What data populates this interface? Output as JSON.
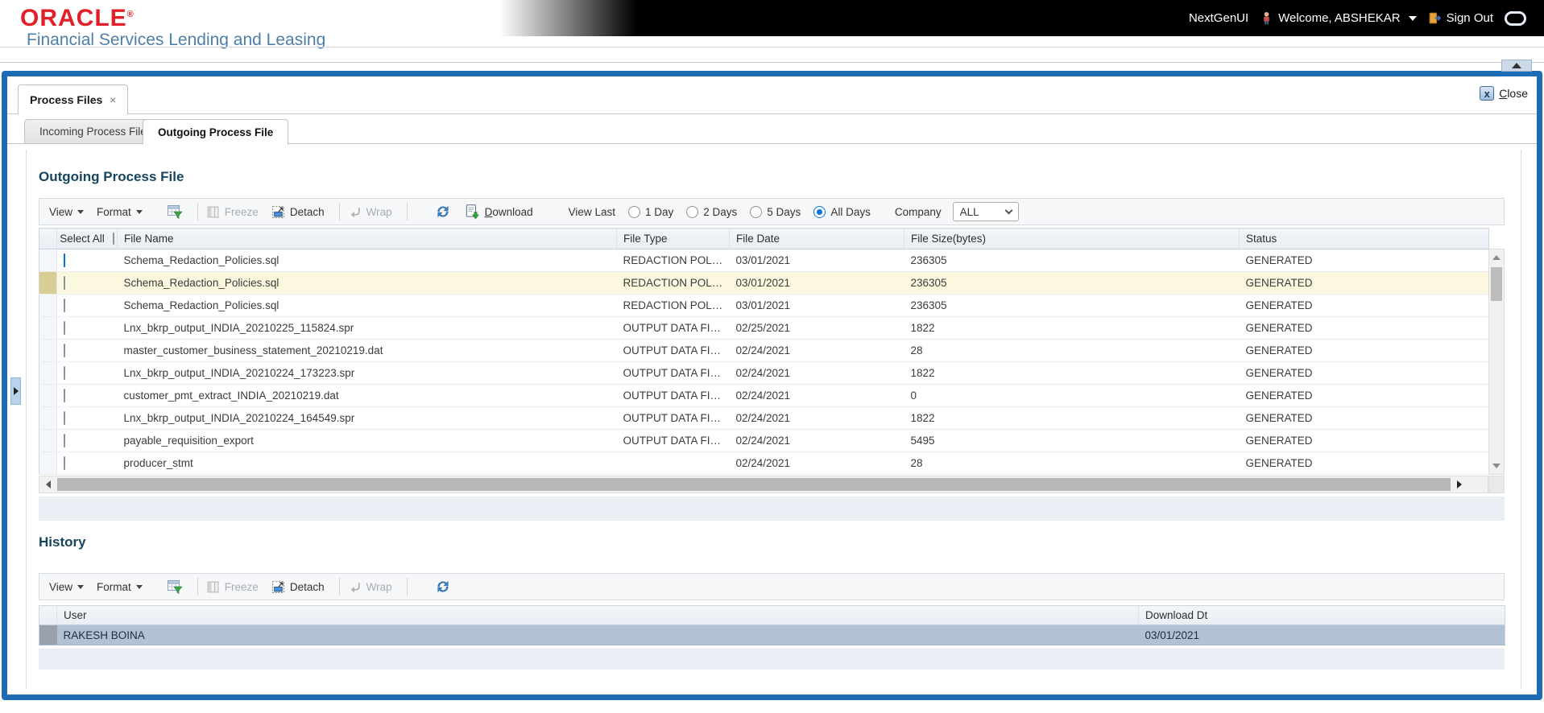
{
  "header": {
    "logo_text": "ORACLE",
    "logo_reg": "®",
    "tagline": "Financial Services Lending and Leasing",
    "topbar": {
      "nextgen_label": "NextGenUI",
      "welcome_label": "Welcome, ABSHEKAR",
      "signout_label": "Sign Out"
    }
  },
  "window": {
    "tab_label": "Process Files",
    "tab_close": "×",
    "close_label": "Close",
    "close_x": "x"
  },
  "subtabs": {
    "incoming": "Incoming Process File",
    "outgoing": "Outgoing Process File"
  },
  "outgoing": {
    "title": "Outgoing Process File",
    "toolbar": {
      "view": "View",
      "format": "Format",
      "freeze": "Freeze",
      "detach": "Detach",
      "wrap": "Wrap",
      "download": "Download"
    },
    "filters": {
      "view_last_label": "View Last",
      "opt_1day": "1 Day",
      "opt_2days": "2 Days",
      "opt_5days": "5 Days",
      "opt_alldays": "All Days",
      "selected_option": "All Days",
      "company_label": "Company",
      "company_value": "ALL"
    },
    "table": {
      "select_all_label": "Select All",
      "col_file_name": "File Name",
      "col_file_type": "File Type",
      "col_file_date": "File Date",
      "col_file_size": "File Size(bytes)",
      "col_status": "Status",
      "rows": [
        {
          "checked": true,
          "selected": false,
          "file_name": "Schema_Redaction_Policies.sql",
          "file_type": "REDACTION POLI...",
          "file_date": "03/01/2021",
          "file_size": "236305",
          "status": "GENERATED"
        },
        {
          "checked": false,
          "selected": true,
          "file_name": "Schema_Redaction_Policies.sql",
          "file_type": "REDACTION POLI...",
          "file_date": "03/01/2021",
          "file_size": "236305",
          "status": "GENERATED"
        },
        {
          "checked": false,
          "selected": false,
          "file_name": "Schema_Redaction_Policies.sql",
          "file_type": "REDACTION POLI...",
          "file_date": "03/01/2021",
          "file_size": "236305",
          "status": "GENERATED"
        },
        {
          "checked": false,
          "selected": false,
          "file_name": "Lnx_bkrp_output_INDIA_20210225_115824.spr",
          "file_type": "OUTPUT DATA FIL...",
          "file_date": "02/25/2021",
          "file_size": "1822",
          "status": "GENERATED"
        },
        {
          "checked": false,
          "selected": false,
          "file_name": "master_customer_business_statement_20210219.dat",
          "file_type": "OUTPUT DATA FIL...",
          "file_date": "02/24/2021",
          "file_size": "28",
          "status": "GENERATED"
        },
        {
          "checked": false,
          "selected": false,
          "file_name": "Lnx_bkrp_output_INDIA_20210224_173223.spr",
          "file_type": "OUTPUT DATA FIL...",
          "file_date": "02/24/2021",
          "file_size": "1822",
          "status": "GENERATED"
        },
        {
          "checked": false,
          "selected": false,
          "file_name": "customer_pmt_extract_INDIA_20210219.dat",
          "file_type": "OUTPUT DATA FIL...",
          "file_date": "02/24/2021",
          "file_size": "0",
          "status": "GENERATED"
        },
        {
          "checked": false,
          "selected": false,
          "file_name": "Lnx_bkrp_output_INDIA_20210224_164549.spr",
          "file_type": "OUTPUT DATA FIL...",
          "file_date": "02/24/2021",
          "file_size": "1822",
          "status": "GENERATED"
        },
        {
          "checked": false,
          "selected": false,
          "file_name": "payable_requisition_export",
          "file_type": "OUTPUT DATA FIL...",
          "file_date": "02/24/2021",
          "file_size": "5495",
          "status": "GENERATED"
        },
        {
          "checked": false,
          "selected": false,
          "file_name": "producer_stmt",
          "file_type": "",
          "file_date": "02/24/2021",
          "file_size": "28",
          "status": "GENERATED"
        }
      ]
    }
  },
  "history": {
    "title": "History",
    "toolbar": {
      "view": "View",
      "format": "Format",
      "freeze": "Freeze",
      "detach": "Detach",
      "wrap": "Wrap"
    },
    "col_user": "User",
    "col_download_dt": "Download Dt",
    "rows": [
      {
        "user": "RAKESH BOINA",
        "download_dt": "03/01/2021"
      }
    ]
  },
  "colors": {
    "panel_border_blue": "#1d6ab5",
    "oracle_red": "#e21f28",
    "tagline_blue": "#4d7fa9",
    "section_title": "#17455e",
    "selected_row_bg": "#fcf7df",
    "selected_row_gutter": "#d9cd96",
    "history_selected_bg": "#b1c2d7",
    "radio_checkbox_blue": "#0b74da"
  }
}
